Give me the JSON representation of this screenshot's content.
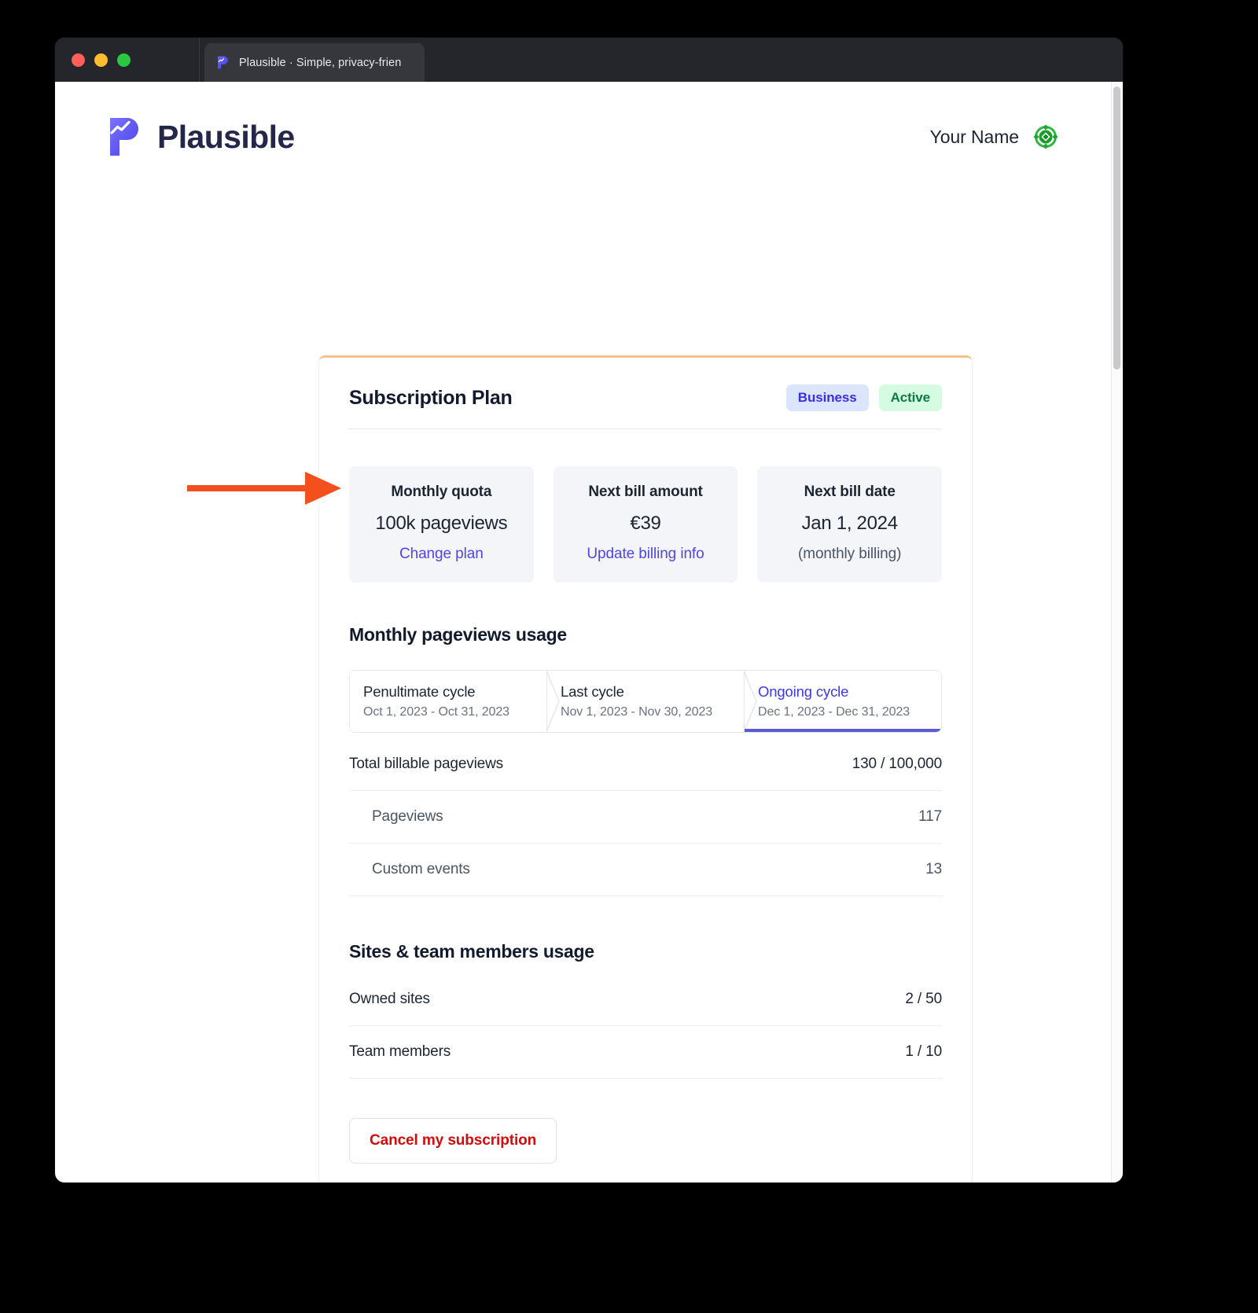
{
  "browser": {
    "tab": {
      "title": "Plausible · Simple, privacy-frien",
      "favicon_icon": "plausible-favicon"
    },
    "traffic_lights": [
      "close-button",
      "minimize-button",
      "maximize-button"
    ]
  },
  "header": {
    "logo_text": "Plausible",
    "logo_icon": "plausible-logo-icon",
    "user_name": "Your Name",
    "avatar_icon": "identicon-avatar"
  },
  "card": {
    "title": "Subscription Plan",
    "plan_badge": "Business",
    "status_badge": "Active",
    "accent_top_border": "#f7c28a",
    "stats": [
      {
        "label": "Monthly quota",
        "value": "100k pageviews",
        "action": "Change plan",
        "action_type": "link"
      },
      {
        "label": "Next bill amount",
        "value": "€39",
        "action": "Update billing info",
        "action_type": "link"
      },
      {
        "label": "Next bill date",
        "value": "Jan 1, 2024",
        "action": "(monthly billing)",
        "action_type": "muted"
      }
    ],
    "usage_section": {
      "title": "Monthly pageviews usage",
      "cycles": [
        {
          "name": "Penultimate cycle",
          "dates": "Oct 1, 2023 - Oct 31, 2023",
          "active": false
        },
        {
          "name": "Last cycle",
          "dates": "Nov 1, 2023 - Nov 30, 2023",
          "active": false
        },
        {
          "name": "Ongoing cycle",
          "dates": "Dec 1, 2023 - Dec 31, 2023",
          "active": true
        }
      ],
      "rows": [
        {
          "label": "Total billable pageviews",
          "value": "130 / 100,000",
          "sub": false
        },
        {
          "label": "Pageviews",
          "value": "117",
          "sub": true
        },
        {
          "label": "Custom events",
          "value": "13",
          "sub": true
        }
      ]
    },
    "sites_section": {
      "title": "Sites & team members usage",
      "rows": [
        {
          "label": "Owned sites",
          "value": "2 / 50",
          "sub": false
        },
        {
          "label": "Team members",
          "value": "1 / 10",
          "sub": false
        }
      ]
    },
    "cancel_label": "Cancel my subscription"
  },
  "annotation": {
    "arrow_color": "#f4501e",
    "arrow_icon": "right-arrow-annotation",
    "points_to": "Change plan"
  },
  "colors": {
    "accent_indigo": "#4f46e5",
    "badge_plan_bg": "#dbe5fe",
    "badge_plan_text": "#3b2ee0",
    "badge_status_bg": "#d6fbe3",
    "badge_status_text": "#0b7a43",
    "danger": "#d40b0b",
    "card_top_border": "#f7c28a"
  }
}
